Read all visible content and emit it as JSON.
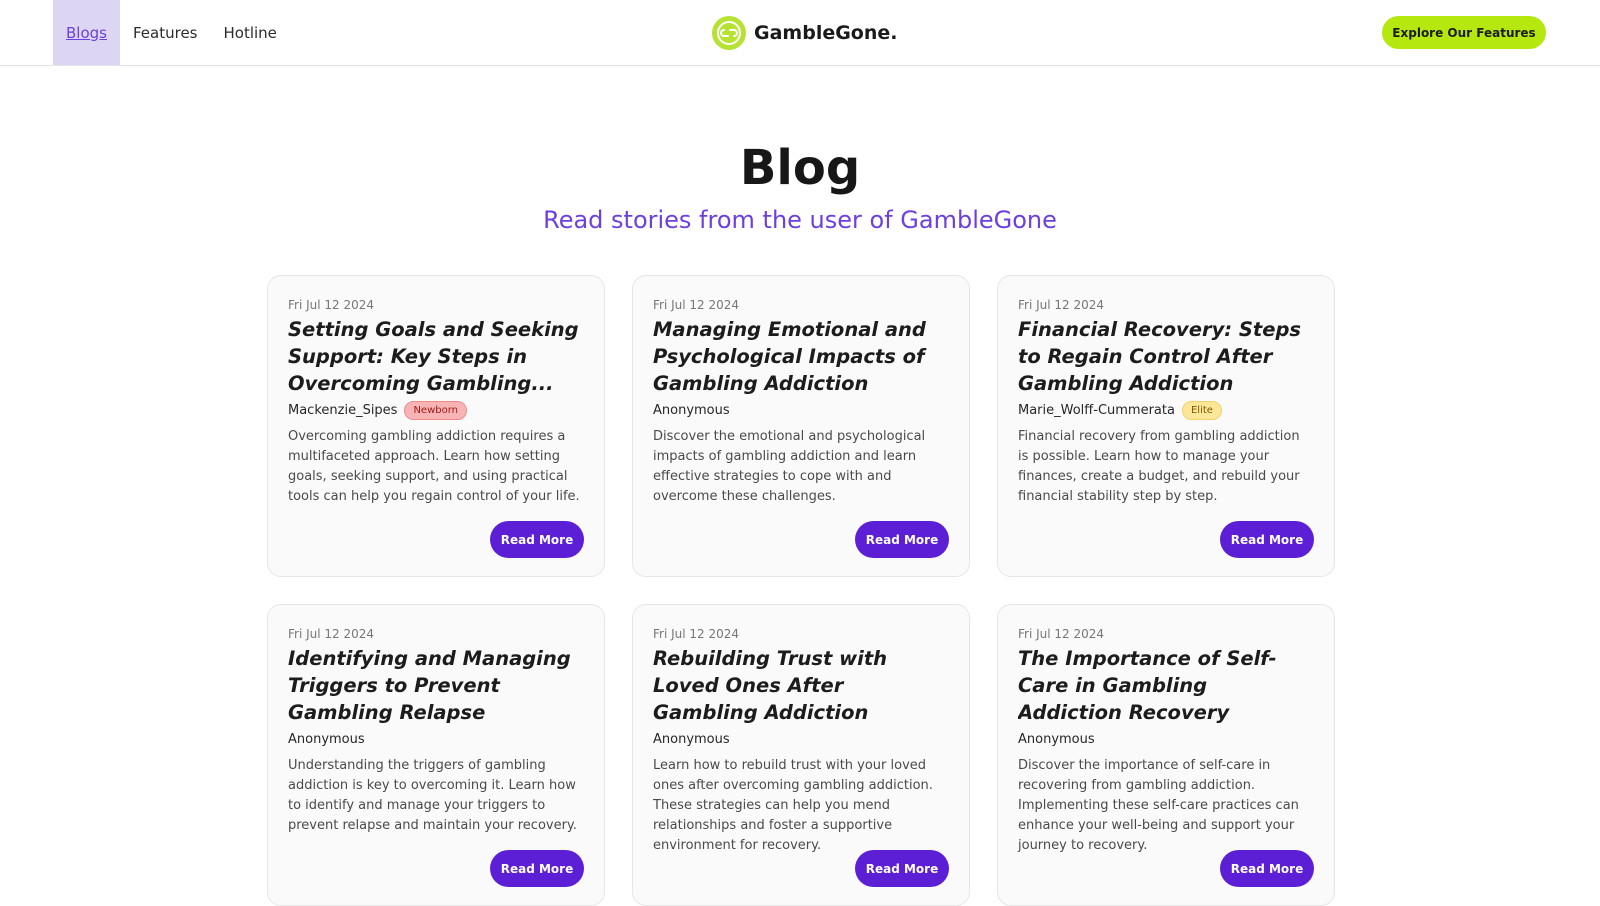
{
  "nav": {
    "links": [
      {
        "label": "Blogs"
      },
      {
        "label": "Features"
      },
      {
        "label": "Hotline"
      }
    ],
    "brand": "GambleGone.",
    "cta_label": "Explore Our Features"
  },
  "page": {
    "title": "Blog",
    "subtitle": "Read stories from the user of GambleGone"
  },
  "colors": {
    "accent": "#5c1fd6",
    "subtitle": "#6d3fe0",
    "cta": "#b4e80f",
    "nav_active_bg": "#ddd6f3"
  },
  "posts": [
    {
      "date": "Fri Jul 12 2024",
      "title": "Setting Goals and Seeking Support: Key Steps in Overcoming Gambling...",
      "author": "Mackenzie_Sipes",
      "badge": "Newborn",
      "excerpt": "Overcoming gambling addiction requires a multifaceted approach. Learn how setting goals, seeking support, and using practical tools can help you regain control of your life.",
      "button": "Read More"
    },
    {
      "date": "Fri Jul 12 2024",
      "title": "Managing Emotional and Psychological Impacts of Gambling Addiction",
      "author": "Anonymous",
      "badge": "",
      "excerpt": "Discover the emotional and psychological impacts of gambling addiction and learn effective strategies to cope with and overcome these challenges.",
      "button": "Read More"
    },
    {
      "date": "Fri Jul 12 2024",
      "title": "Financial Recovery: Steps to Regain Control After Gambling Addiction",
      "author": "Marie_Wolff-Cummerata",
      "badge": "Elite",
      "excerpt": "Financial recovery from gambling addiction is possible. Learn how to manage your finances, create a budget, and rebuild your financial stability step by step.",
      "button": "Read More"
    },
    {
      "date": "Fri Jul 12 2024",
      "title": "Identifying and Managing Triggers to Prevent Gambling Relapse",
      "author": "Anonymous",
      "badge": "",
      "excerpt": "Understanding the triggers of gambling addiction is key to overcoming it. Learn how to identify and manage your triggers to prevent relapse and maintain your recovery.",
      "button": "Read More"
    },
    {
      "date": "Fri Jul 12 2024",
      "title": "Rebuilding Trust with Loved Ones After Gambling Addiction",
      "author": "Anonymous",
      "badge": "",
      "excerpt": "Learn how to rebuild trust with your loved ones after overcoming gambling addiction. These strategies can help you mend relationships and foster a supportive environment for recovery.",
      "button": "Read More"
    },
    {
      "date": "Fri Jul 12 2024",
      "title": "The Importance of Self-Care in Gambling Addiction Recovery",
      "author": "Anonymous",
      "badge": "",
      "excerpt": "Discover the importance of self-care in recovering from gambling addiction. Implementing these self-care practices can enhance your well-being and support your journey to recovery.",
      "button": "Read More"
    }
  ]
}
